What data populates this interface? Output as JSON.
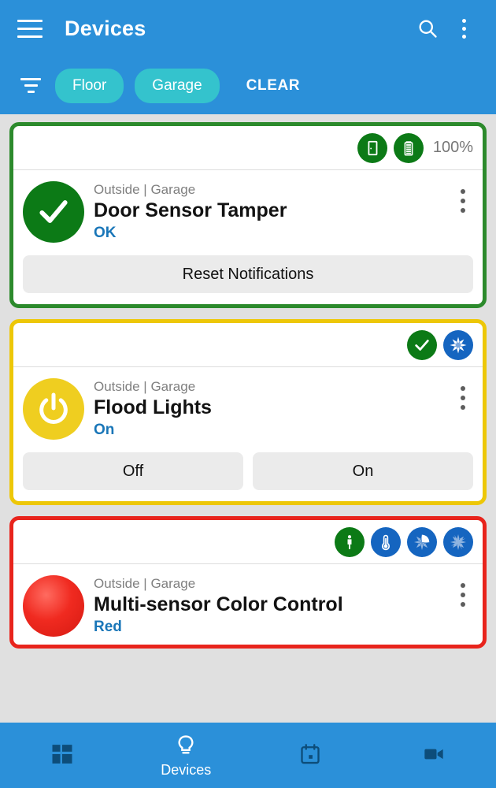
{
  "appbar": {
    "title": "Devices",
    "menu_icon": "hamburger-icon",
    "search_icon": "search-icon",
    "overflow_icon": "more-vert-icon",
    "filter_icon": "filter-icon",
    "chips": [
      {
        "label": "Floor"
      },
      {
        "label": "Garage"
      }
    ],
    "clear_label": "CLEAR"
  },
  "colors": {
    "header_blue": "#2b90d9",
    "chip_teal": "#34c3cd",
    "card_green": "#2c8a2c",
    "card_yellow": "#edc707",
    "card_red": "#e8241c",
    "badge_green": "#0c7a16",
    "badge_blue": "#1565c0",
    "state_blue": "#1976b8",
    "background": "#e0e0e0"
  },
  "cards": [
    {
      "border": "green",
      "status_icons": [
        {
          "name": "door-icon",
          "color": "green"
        },
        {
          "name": "battery-icon",
          "color": "green"
        }
      ],
      "battery_label": "100%",
      "device_icon": "check-circle-icon",
      "device_icon_style": "green",
      "location": "Outside | Garage",
      "name": "Door Sensor Tamper",
      "state": "OK",
      "actions": [
        {
          "label": "Reset Notifications"
        }
      ]
    },
    {
      "border": "yellow",
      "status_icons": [
        {
          "name": "check-icon",
          "color": "green"
        },
        {
          "name": "starburst-icon",
          "color": "blue"
        }
      ],
      "battery_label": "",
      "device_icon": "power-icon",
      "device_icon_style": "yellow",
      "location": "Outside | Garage",
      "name": "Flood Lights",
      "state": "On",
      "actions": [
        {
          "label": "Off"
        },
        {
          "label": "On"
        }
      ]
    },
    {
      "border": "red",
      "status_icons": [
        {
          "name": "motion-person-icon",
          "color": "green"
        },
        {
          "name": "thermometer-icon",
          "color": "blue"
        },
        {
          "name": "humidity-burst-icon",
          "color": "blue"
        },
        {
          "name": "illuminance-burst-icon",
          "color": "blue"
        }
      ],
      "battery_label": "",
      "device_icon": "color-bulb-icon",
      "device_icon_style": "redball",
      "location": "Outside | Garage",
      "name": "Multi-sensor Color Control",
      "state": "Red",
      "actions": []
    }
  ],
  "bottomnav": {
    "items": [
      {
        "icon": "dashboard-grid-icon",
        "label": "",
        "active": false
      },
      {
        "icon": "lightbulb-icon",
        "label": "Devices",
        "active": true
      },
      {
        "icon": "calendar-icon",
        "label": "",
        "active": false
      },
      {
        "icon": "video-camera-icon",
        "label": "",
        "active": false
      }
    ]
  }
}
